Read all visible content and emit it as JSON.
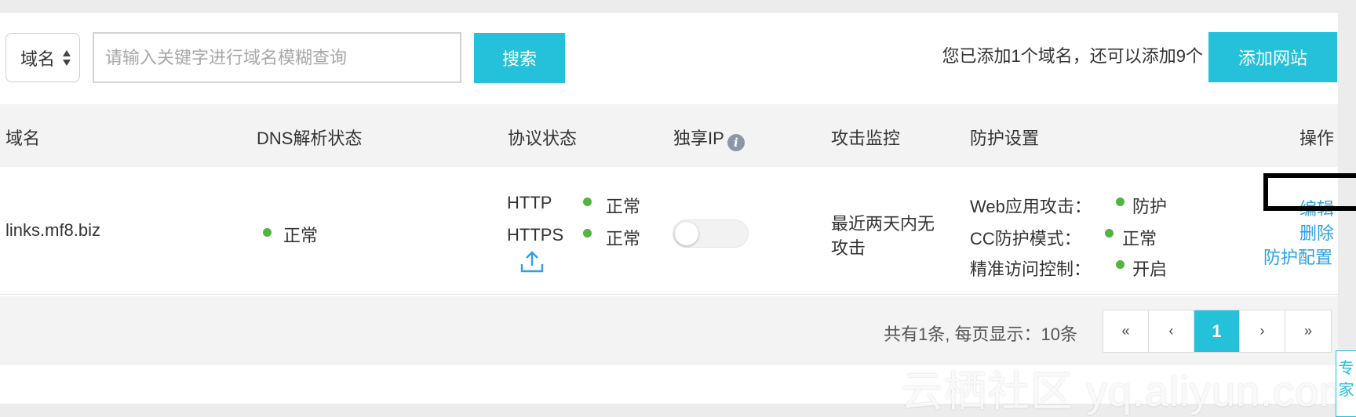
{
  "toolbar": {
    "filter_select": "域名",
    "search_placeholder": "请输入关键字进行域名模糊查询",
    "search_button": "搜索",
    "quota_text": "您已添加1个域名，还可以添加9个",
    "add_button": "添加网站"
  },
  "table": {
    "headers": {
      "domain": "域名",
      "dns": "DNS解析状态",
      "protocol": "协议状态",
      "dedicated_ip": "独享IP",
      "attack": "攻击监控",
      "protection": "防护设置",
      "action": "操作"
    },
    "rows": [
      {
        "domain": "links.mf8.biz",
        "dns_status": "正常",
        "http_label": "HTTP",
        "http_status": "正常",
        "https_label": "HTTPS",
        "https_status": "正常",
        "dedicated_ip_enabled": false,
        "attack_line1": "最近两天内无",
        "attack_line2": "攻击",
        "web_label": "Web应用攻击：",
        "web_status": "防护",
        "cc_label": "CC防护模式：",
        "cc_status": "正常",
        "acl_label": "精准访问控制：",
        "acl_status": "开启",
        "action_edit": "编辑",
        "action_delete": "删除",
        "action_config": "防护配置"
      }
    ]
  },
  "pagination": {
    "summary": "共有1条, 每页显示：10条",
    "first": "«",
    "prev": "‹",
    "current": "1",
    "next": "›",
    "last": "»"
  },
  "watermark": "云栖社区 yq.aliyun.com",
  "sidetab": "专家",
  "colors": {
    "accent": "#25c0d9",
    "link": "#2ba0e6",
    "status_ok": "#52b53f"
  }
}
